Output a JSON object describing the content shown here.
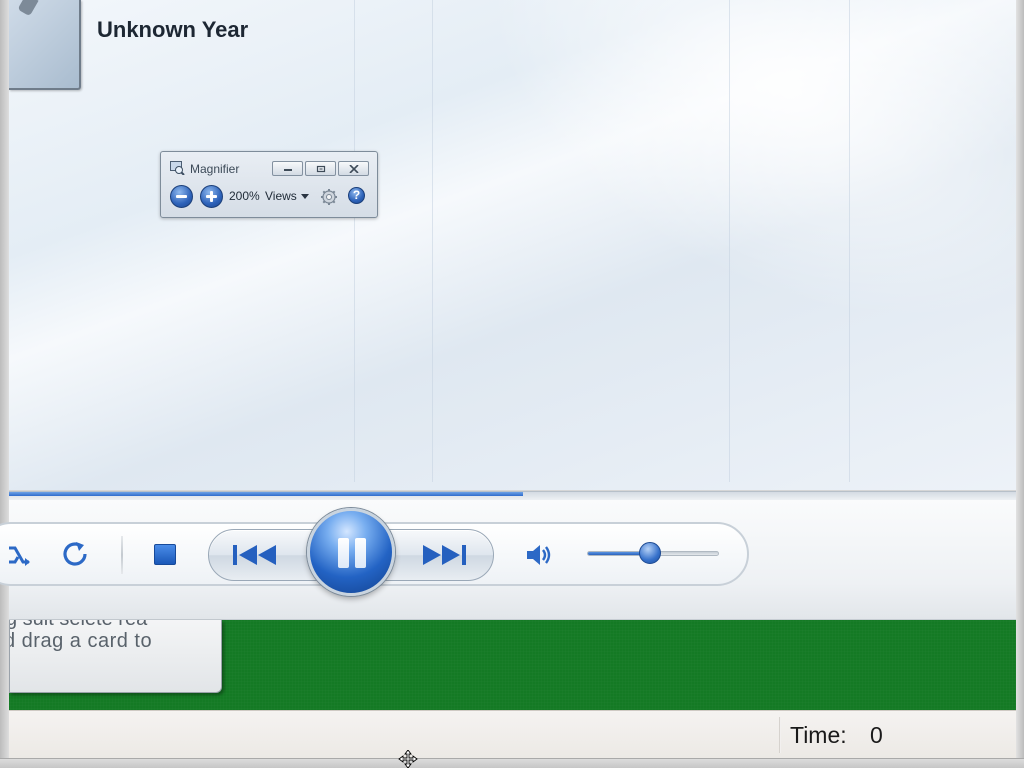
{
  "library": {
    "album_year": "Unknown Year"
  },
  "magnifier": {
    "title": "Magnifier",
    "zoom_level": "200%",
    "views_label": "Views",
    "help_label": "?"
  },
  "player": {
    "seek_progress": 0.51,
    "volume_level": 0.48,
    "state": "playing"
  },
  "game": {
    "tip_line_1": "g  sult  selete  rea",
    "tip_line_2": "d drag a card to"
  },
  "status": {
    "time_label": "Time:",
    "time_value": "0"
  },
  "colors": {
    "accent_blue": "#2d62b9",
    "felt_green": "#147a24"
  }
}
